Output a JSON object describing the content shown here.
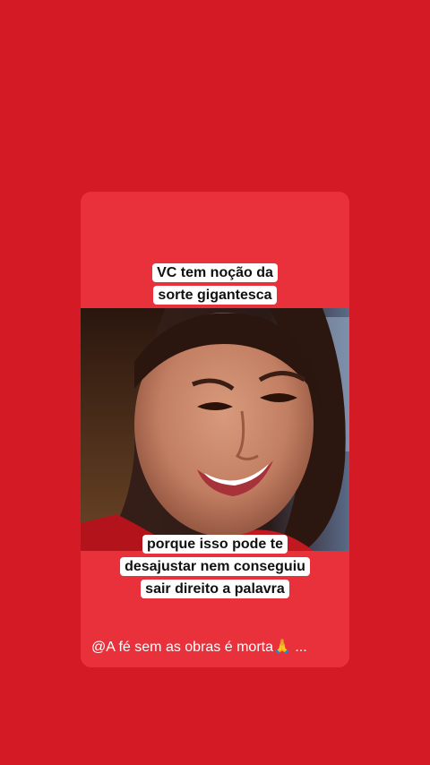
{
  "story": {
    "caption_top_line1": "VC tem noção da",
    "caption_top_line2": "sorte gigantesca",
    "caption_bottom_line1": "porque isso pode te",
    "caption_bottom_line2": "desajustar nem conseguiu",
    "caption_bottom_line3": "sair direito a palavra",
    "footer_credit": "@A fé sem as obras é morta🙏 ..."
  },
  "colors": {
    "background": "#d41a24",
    "card": "#e8313b",
    "caption_bg": "#ffffff",
    "caption_text": "#111111"
  }
}
